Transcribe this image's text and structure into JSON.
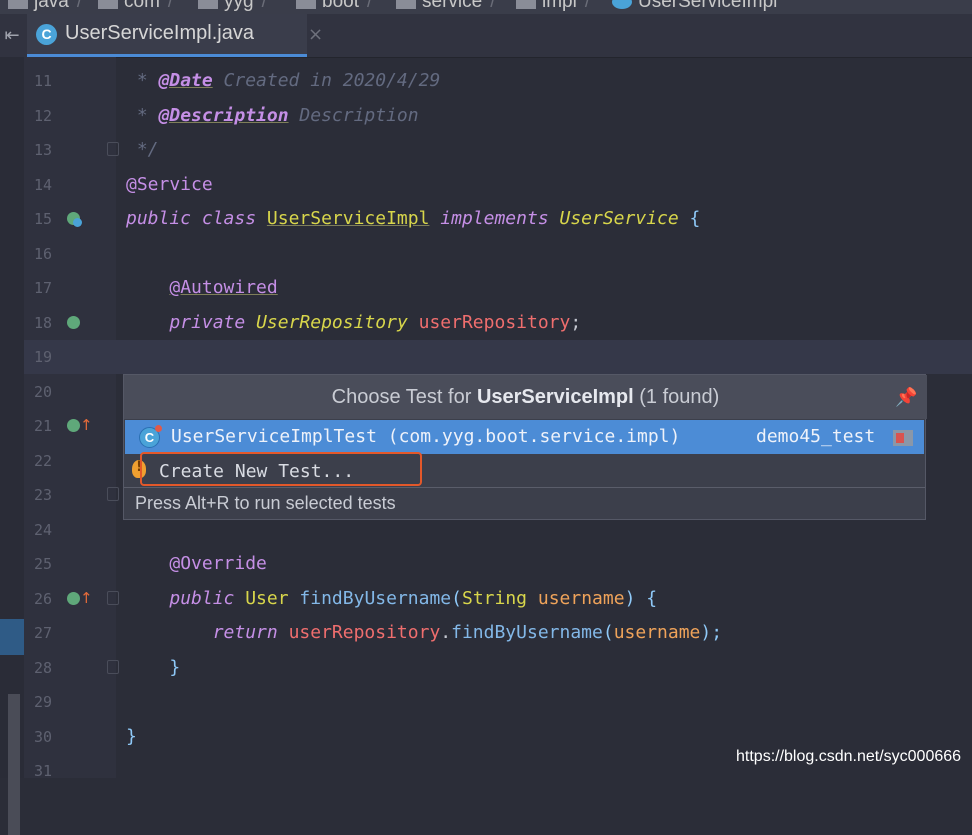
{
  "breadcrumb": {
    "items": [
      "java",
      "com",
      "yyg",
      "boot",
      "service",
      "impl",
      "UserServiceImpl"
    ]
  },
  "editor_tab": {
    "icon": "class-icon",
    "icon_letter": "C",
    "filename": "UserServiceImpl.java",
    "close_glyph": "×"
  },
  "editor": {
    "lines": [
      {
        "num": "11",
        "code": " * @Date Created in 2020/4/29"
      },
      {
        "num": "12",
        "code": " * @Description Description"
      },
      {
        "num": "13",
        "code": " */"
      },
      {
        "num": "14",
        "code": "@Service"
      },
      {
        "num": "15",
        "code": "public class UserServiceImpl implements UserService {"
      },
      {
        "num": "16",
        "code": ""
      },
      {
        "num": "17",
        "code": "    @Autowired"
      },
      {
        "num": "18",
        "code": "    private UserRepository userRepository;"
      },
      {
        "num": "19",
        "code": ""
      },
      {
        "num": "20",
        "code": ""
      },
      {
        "num": "21",
        "code": ""
      },
      {
        "num": "22",
        "code": ""
      },
      {
        "num": "23",
        "code": ""
      },
      {
        "num": "24",
        "code": ""
      },
      {
        "num": "25",
        "code": "    @Override"
      },
      {
        "num": "26",
        "code": "    public User findByUsername(String username) {"
      },
      {
        "num": "27",
        "code": "        return userRepository.findByUsername(username);"
      },
      {
        "num": "28",
        "code": "    }"
      },
      {
        "num": "29",
        "code": ""
      },
      {
        "num": "30",
        "code": "}"
      },
      {
        "num": "31",
        "code": ""
      }
    ],
    "tokens": {
      "l11_star": " * ",
      "l11_tag": "@Date",
      "l11_text": " Created in 2020/4/29",
      "l12_star": " * ",
      "l12_tag": "@Description",
      "l12_text": " Description",
      "l13": " */",
      "l14": "@Service",
      "l15_kw": "public class ",
      "l15_cls": "UserServiceImpl",
      "l15_impl": " implements ",
      "l15_iface": "UserService",
      "l15_brace": " {",
      "l17_indent": "    ",
      "l17": "@Autowired",
      "l18_indent": "    ",
      "l18_kw": "private ",
      "l18_type": "UserRepository",
      "l18_sp": " ",
      "l18_field": "userRepository",
      "l18_semi": ";",
      "l25_indent": "    ",
      "l25": "@Override",
      "l26_indent": "    ",
      "l26_kw": "public ",
      "l26_type": "User",
      "l26_sp": " ",
      "l26_method": "findByUsername",
      "l26_paren": "(",
      "l26_ptype": "String",
      "l26_sp2": " ",
      "l26_param": "username",
      "l26_close": ") {",
      "l27_indent": "        ",
      "l27_kw": "return ",
      "l27_field": "userRepository",
      "l27_dot": ".",
      "l27_method": "findByUsername",
      "l27_paren": "(",
      "l27_param": "username",
      "l27_end": ");",
      "l28": "    }",
      "l30": "}"
    }
  },
  "gutter_icons": {
    "line15": "implemented-class-icon",
    "line18": "autowired-bean-icon",
    "line21": "override-up-arrow-icon",
    "line26": "override-up-arrow-icon"
  },
  "popup": {
    "title_prefix": "Choose Test for ",
    "title_class": "UserServiceImpl",
    "title_suffix": " (1 found)",
    "pin_icon": "pin-icon",
    "pin_glyph": "📌",
    "items": [
      {
        "icon": "test-class-icon",
        "icon_letter": "C",
        "label": "UserServiceImplTest (com.yyg.boot.service.impl)",
        "module": "demo45_test",
        "module_icon": "module-icon",
        "selected": true
      },
      {
        "icon": "bulb-icon",
        "label": "Create New Test...",
        "selected": false
      }
    ],
    "footer": "Press Alt+R to run selected tests"
  },
  "collapse_glyph": "⇤",
  "watermark": "https://blog.csdn.net/syc000666",
  "colors": {
    "background": "#2b2d38",
    "selection": "#4c8cd6",
    "highlight_box": "#e3582a",
    "keyword": "#c58fe6",
    "type": "#d8d64b",
    "field": "#ef6e6e"
  }
}
